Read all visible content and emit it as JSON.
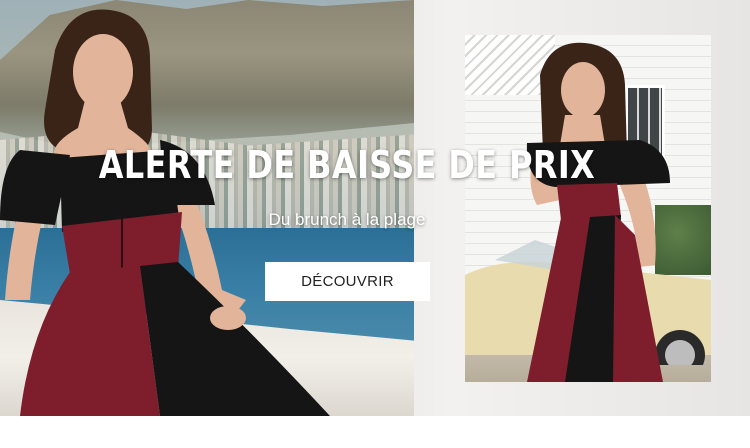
{
  "banner": {
    "headline": "ALERTE DE BAISSE DE PRIX",
    "subheadline": "Du brunch à la plage",
    "cta_label": "DÉCOUVRIR"
  },
  "colors": {
    "dress_burgundy": "#7e1d2c",
    "dress_black": "#151515",
    "cta_background": "#ffffff",
    "cta_text": "#222222"
  }
}
